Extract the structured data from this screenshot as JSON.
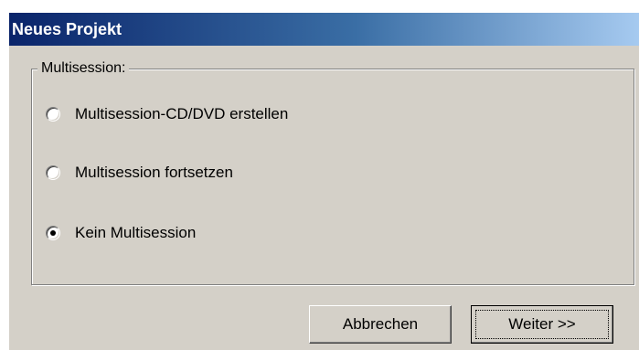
{
  "window": {
    "title": "Neues Projekt"
  },
  "multisession": {
    "group_label": "Multisession:",
    "options": [
      {
        "label": "Multisession-CD/DVD erstellen",
        "selected": false
      },
      {
        "label": "Multisession fortsetzen",
        "selected": false
      },
      {
        "label": "Kein Multisession",
        "selected": true
      }
    ]
  },
  "buttons": {
    "cancel_label": "Abbrechen",
    "next_label": "Weiter >>"
  },
  "colors": {
    "dialog_background": "#d4d0c8",
    "titlebar_start": "#0a246a",
    "titlebar_end": "#a6caf0"
  }
}
